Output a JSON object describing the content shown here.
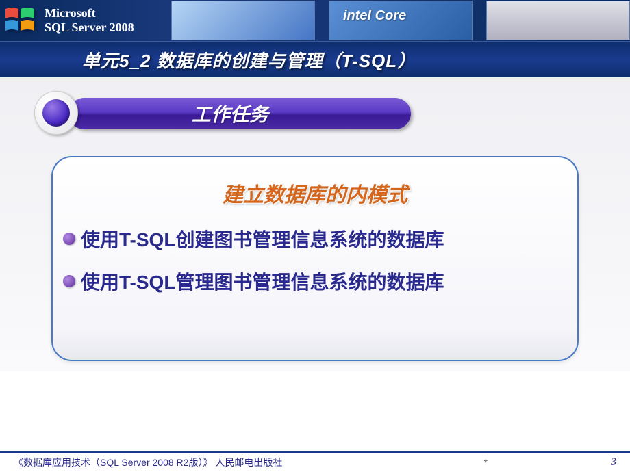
{
  "brand": {
    "line1": "Microsoft",
    "line2": "SQL Server 2008"
  },
  "title": "单元5_2 数据库的创建与管理（T-SQL）",
  "section": {
    "label": "工作任务"
  },
  "content": {
    "heading": "建立数据库的内模式",
    "bullets": [
      "使用T-SQL创建图书管理信息系统的数据库",
      "使用T-SQL管理图书管理信息系统的数据库"
    ]
  },
  "footer": {
    "book": "《数据库应用技术（SQL Server 2008 R2版）》 人民邮电出版社",
    "date": "*",
    "page": "3"
  }
}
